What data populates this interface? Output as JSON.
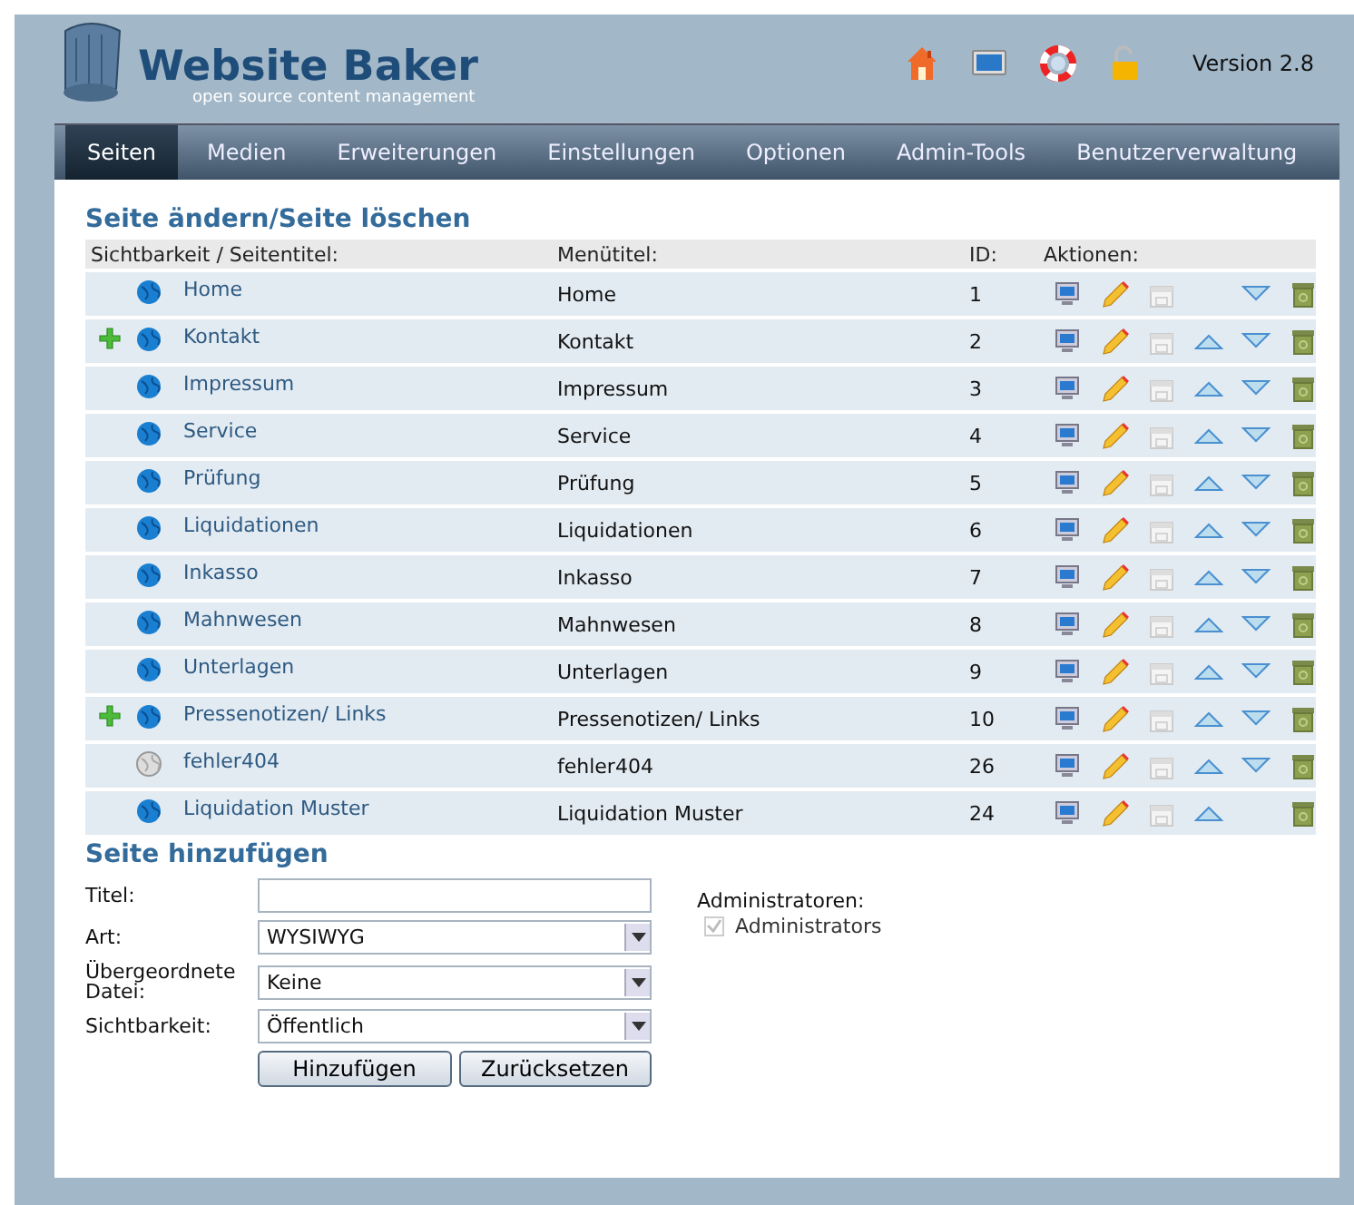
{
  "header": {
    "logo_title": "Website Baker",
    "logo_subtitle": "open source content management",
    "version": "Version 2.8"
  },
  "nav": [
    {
      "label": "Seiten",
      "selected": true
    },
    {
      "label": "Medien",
      "selected": false
    },
    {
      "label": "Erweiterungen",
      "selected": false
    },
    {
      "label": "Einstellungen",
      "selected": false
    },
    {
      "label": "Optionen",
      "selected": false
    },
    {
      "label": "Admin-Tools",
      "selected": false
    },
    {
      "label": "Benutzerverwaltung",
      "selected": false
    }
  ],
  "pages": {
    "heading": "Seite ändern/Seite löschen",
    "columns": [
      "Sichtbarkeit / Seitentitel:",
      "Menütitel:",
      "ID:",
      "Aktionen:"
    ],
    "rows": [
      {
        "has_children": false,
        "public": true,
        "title": "Home",
        "menu_title": "Home",
        "id": "1",
        "move_up": false,
        "move_down": true
      },
      {
        "has_children": true,
        "public": true,
        "title": "Kontakt",
        "menu_title": "Kontakt",
        "id": "2",
        "move_up": true,
        "move_down": true
      },
      {
        "has_children": false,
        "public": true,
        "title": "Impressum",
        "menu_title": "Impressum",
        "id": "3",
        "move_up": true,
        "move_down": true
      },
      {
        "has_children": false,
        "public": true,
        "title": "Service",
        "menu_title": "Service",
        "id": "4",
        "move_up": true,
        "move_down": true
      },
      {
        "has_children": false,
        "public": true,
        "title": "Prüfung",
        "menu_title": "Prüfung",
        "id": "5",
        "move_up": true,
        "move_down": true
      },
      {
        "has_children": false,
        "public": true,
        "title": "Liquidationen",
        "menu_title": "Liquidationen",
        "id": "6",
        "move_up": true,
        "move_down": true
      },
      {
        "has_children": false,
        "public": true,
        "title": "Inkasso",
        "menu_title": "Inkasso",
        "id": "7",
        "move_up": true,
        "move_down": true
      },
      {
        "has_children": false,
        "public": true,
        "title": "Mahnwesen",
        "menu_title": "Mahnwesen",
        "id": "8",
        "move_up": true,
        "move_down": true
      },
      {
        "has_children": false,
        "public": true,
        "title": "Unterlagen",
        "menu_title": "Unterlagen",
        "id": "9",
        "move_up": true,
        "move_down": true
      },
      {
        "has_children": true,
        "public": true,
        "title": "Pressenotizen/ Links",
        "menu_title": "Pressenotizen/ Links",
        "id": "10",
        "move_up": true,
        "move_down": true
      },
      {
        "has_children": false,
        "public": false,
        "title": "fehler404",
        "menu_title": "fehler404",
        "id": "26",
        "move_up": true,
        "move_down": true
      },
      {
        "has_children": false,
        "public": true,
        "title": "Liquidation Muster",
        "menu_title": "Liquidation Muster",
        "id": "24",
        "move_up": true,
        "move_down": false
      }
    ]
  },
  "add_page": {
    "heading": "Seite hinzufügen",
    "fields": [
      {
        "label": "Titel:",
        "kind": "text"
      },
      {
        "label": "Art:",
        "kind": "select",
        "value": "WYSIWYG"
      },
      {
        "label": "Übergeordnete Datei:",
        "kind": "select",
        "value": "Keine"
      },
      {
        "label": "Sichtbarkeit:",
        "kind": "select",
        "value": "Öffentlich"
      }
    ],
    "buttons": [
      "Hinzufügen",
      "Zurücksetzen"
    ],
    "admins": {
      "label": "Administratoren:",
      "options": [
        {
          "label": "Administrators",
          "checked": true,
          "disabled": true
        }
      ]
    }
  }
}
